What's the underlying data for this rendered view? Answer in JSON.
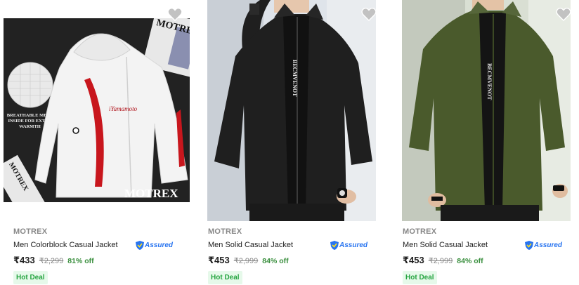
{
  "products": [
    {
      "brand": "MOTREX",
      "title": "Men Colorblock Casual Jacket",
      "assured": "Assured",
      "price": "₹433",
      "mrp": "₹2,299",
      "discount": "81% off",
      "badge": "Hot Deal",
      "image_text": {
        "brand_mark": "MOTREX",
        "brand_mark_top": "MOTREX",
        "brand_mark_left": "MOTREX",
        "script": "iYamamoto",
        "mesh_caption": "BREATHABLE MESH INSIDE FOR EXTRA WARMTH"
      },
      "jacket_color": "#f3f3f3"
    },
    {
      "brand": "MOTREX",
      "title": "Men Solid Casual Jacket",
      "assured": "Assured",
      "price": "₹453",
      "mrp": "₹2,999",
      "discount": "84% off",
      "badge": "Hot Deal",
      "image_text": {
        "zip_print": "BECMVENOT"
      },
      "jacket_color": "#1f1f1f"
    },
    {
      "brand": "MOTREX",
      "title": "Men Solid Casual Jacket",
      "assured": "Assured",
      "price": "₹453",
      "mrp": "₹2,999",
      "discount": "84% off",
      "badge": "Hot Deal",
      "image_text": {
        "zip_print": "BECMVENOT"
      },
      "jacket_color": "#4a5a2c"
    }
  ],
  "colors": {
    "accent_blue": "#2874f0",
    "discount_green": "#388e3c",
    "deal_bg": "#e6f9ea",
    "deal_text": "#26a541"
  }
}
